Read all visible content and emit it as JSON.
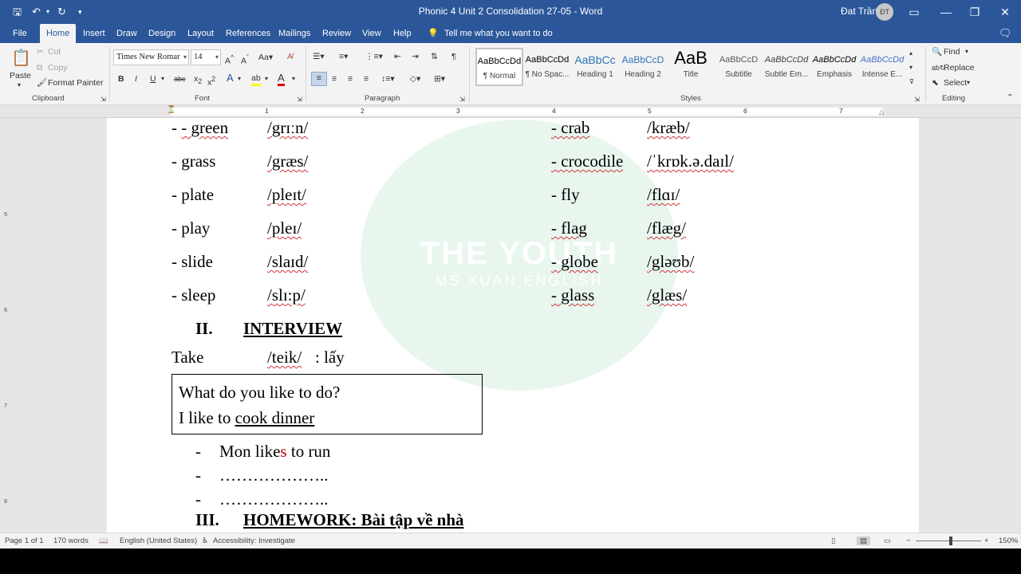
{
  "app": {
    "title": "Phonic 4 Unit 2 Consolidation 27-05  -  Word",
    "user_name": "Đat Trần",
    "user_initials": "ĐT"
  },
  "tabs": [
    "File",
    "Home",
    "Insert",
    "Draw",
    "Design",
    "Layout",
    "References",
    "Mailings",
    "Review",
    "View",
    "Help"
  ],
  "tell_me": "Tell me what you want to do",
  "ribbon": {
    "clipboard": {
      "paste": "Paste",
      "cut": "Cut",
      "copy": "Copy",
      "format_painter": "Format Painter",
      "label": "Clipboard"
    },
    "font": {
      "name": "Times New Romar",
      "size": "14",
      "label": "Font"
    },
    "paragraph": {
      "label": "Paragraph"
    },
    "styles": {
      "label": "Styles",
      "items": [
        {
          "sample": "AaBbCcDd",
          "name": "¶ Normal"
        },
        {
          "sample": "AaBbCcDd",
          "name": "¶ No Spac..."
        },
        {
          "sample": "AaBbCc",
          "name": "Heading 1"
        },
        {
          "sample": "AaBbCcD",
          "name": "Heading 2"
        },
        {
          "sample": "AaB",
          "name": "Title"
        },
        {
          "sample": "AaBbCcD",
          "name": "Subtitle"
        },
        {
          "sample": "AaBbCcDd",
          "name": "Subtle Em..."
        },
        {
          "sample": "AaBbCcDd",
          "name": "Emphasis"
        },
        {
          "sample": "AaBbCcDd",
          "name": "Intense E..."
        }
      ]
    },
    "editing": {
      "find": "Find",
      "replace": "Replace",
      "select": "Select",
      "label": "Editing"
    }
  },
  "document": {
    "vocab_left": [
      {
        "word": "- green",
        "ipa": "/grɪːn/"
      },
      {
        "word": "- grass",
        "ipa": "/græs/"
      },
      {
        "word": "- plate",
        "ipa": "/pleɪt/"
      },
      {
        "word": "- play",
        "ipa": "/pleɪ/"
      },
      {
        "word": "- slide",
        "ipa": "/slaɪd/"
      },
      {
        "word": "- sleep",
        "ipa": "/slɪ:p/"
      }
    ],
    "vocab_right": [
      {
        "word": "- crab",
        "ipa": "/kræb/"
      },
      {
        "word": "- crocodile",
        "ipa": "/ˈkrɒk.ə.daɪl/"
      },
      {
        "word": "- fly",
        "ipa": "/flɑɪ/"
      },
      {
        "word": "- flag",
        "ipa": "/flæg/"
      },
      {
        "word": "- globe",
        "ipa": "/gləʊb/"
      },
      {
        "word": "- glass",
        "ipa": "/glæs/"
      }
    ],
    "section2_num": "II.",
    "section2_title": "INTERVIEW",
    "take_word": "Take",
    "take_ipa": "/teik/",
    "take_meaning": ": lấy",
    "box_line1": "What do you like to do?",
    "box_line2_prefix": "I like to ",
    "box_line2_underlined": "cook dinner",
    "bullet1_a": "Mon like",
    "bullet1_s": "s",
    "bullet1_b": " to run",
    "bullet_dash": "-",
    "bullet_dots": "………………..",
    "section3_num": "III.",
    "section3_title": "HOMEWORK: Bài tập về nhà",
    "watermark_title": "THE YOUTH",
    "watermark_sub": "MS XUAN ENGLISH"
  },
  "status": {
    "page": "Page 1 of 1",
    "words": "170 words",
    "language": "English (United States)",
    "accessibility": "Accessibility: Investigate",
    "zoom": "150%"
  },
  "ruler_numbers": [
    "1",
    "2",
    "3",
    "4",
    "5",
    "6",
    "7"
  ],
  "vruler_numbers": [
    "5",
    "6",
    "7",
    "8"
  ],
  "colors": {
    "accent": "#2b579a",
    "ribbon": "#f3f3f3",
    "spell": "#d13438"
  }
}
